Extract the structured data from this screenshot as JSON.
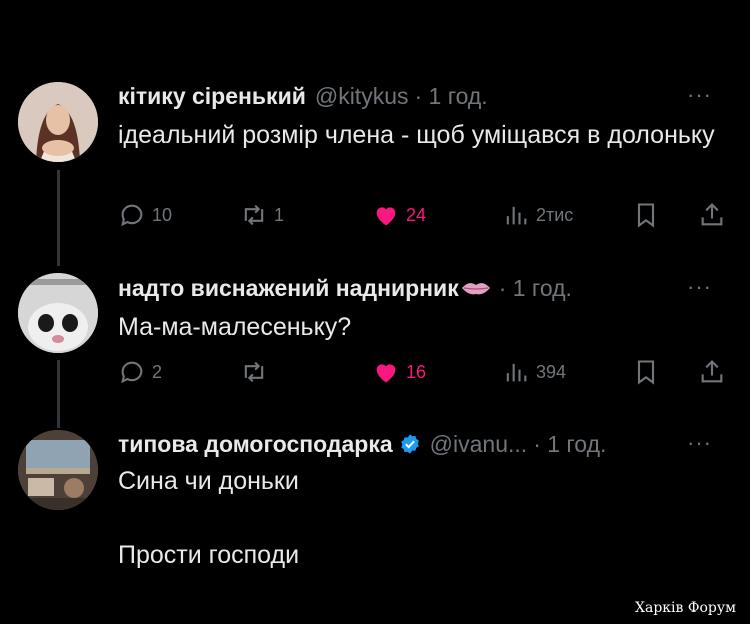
{
  "tweets": [
    {
      "name": "кітику сіренький",
      "handle": "@kitykus",
      "time": "· 1 год.",
      "text": "ідеальний розмір члена - щоб уміщався в долоньку",
      "actions": {
        "reply": "10",
        "retweet": "1",
        "like": "24",
        "views": "2тис"
      },
      "avatar_icon": "portrait-photo"
    },
    {
      "name": "надто виснажений наднирник",
      "name_emoji": "lips-emoji",
      "time": "· 1 год.",
      "text": "Ма-ма-малесеньку?",
      "actions": {
        "reply": "2",
        "retweet": "",
        "like": "16",
        "views": "394"
      },
      "avatar_icon": "cat-photo"
    },
    {
      "name": "типова домогосподарка",
      "verified_icon": "verified-badge-icon",
      "handle": "@ivanu...",
      "time": "· 1 год.",
      "text_lines": [
        "Сина чи доньки",
        "Прости господи"
      ],
      "avatar_icon": "room-photo"
    }
  ],
  "more_label": "···",
  "watermark": "Харків Форум",
  "colors": {
    "background": "#000000",
    "text": "#e7e9ea",
    "muted": "#71767b",
    "like": "#f91880",
    "verified": "#1d9bf0"
  }
}
